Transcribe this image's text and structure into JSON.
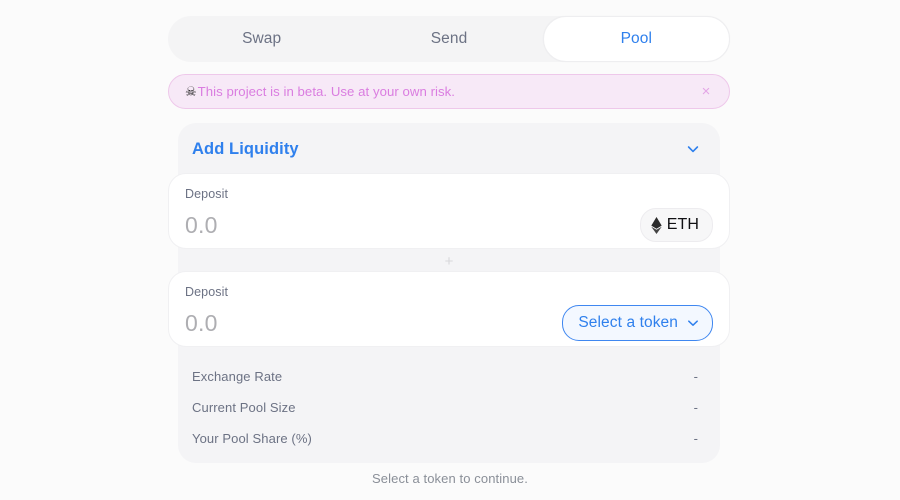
{
  "tabs": [
    {
      "label": "Swap",
      "active": false
    },
    {
      "label": "Send",
      "active": false
    },
    {
      "label": "Pool",
      "active": true
    }
  ],
  "banner": {
    "icon": "skull-icon",
    "icon_glyph": "☠",
    "text": "This project is in beta. Use at your own risk.",
    "close_glyph": "×",
    "text_color": "#da7de0",
    "background_color": "#f7e9f7",
    "border_color": "#eec8ea"
  },
  "panel": {
    "title": "Add Liquidity",
    "title_color": "#2f80ed",
    "chevron": "chevron-down-icon",
    "deposits": [
      {
        "label": "Deposit",
        "value": "",
        "placeholder": "0.0",
        "token": {
          "selected": true,
          "symbol": "ETH",
          "icon": "ethereum-icon"
        }
      },
      {
        "label": "Deposit",
        "value": "",
        "placeholder": "0.0",
        "token": {
          "selected": false,
          "symbol": "Select a token",
          "icon": "chevron-down-icon"
        }
      }
    ],
    "divider_glyph": "+",
    "stats": [
      {
        "label": "Exchange Rate",
        "value": "-"
      },
      {
        "label": "Current Pool Size",
        "value": "-"
      },
      {
        "label": "Your Pool Share (%)",
        "value": "-"
      }
    ]
  },
  "footer": {
    "message": "Select a token to continue."
  },
  "colors": {
    "accent": "#2f80ed",
    "page_background": "#fbfbfb",
    "panel_background": "#f4f4f6",
    "muted_text": "#6c7284"
  }
}
